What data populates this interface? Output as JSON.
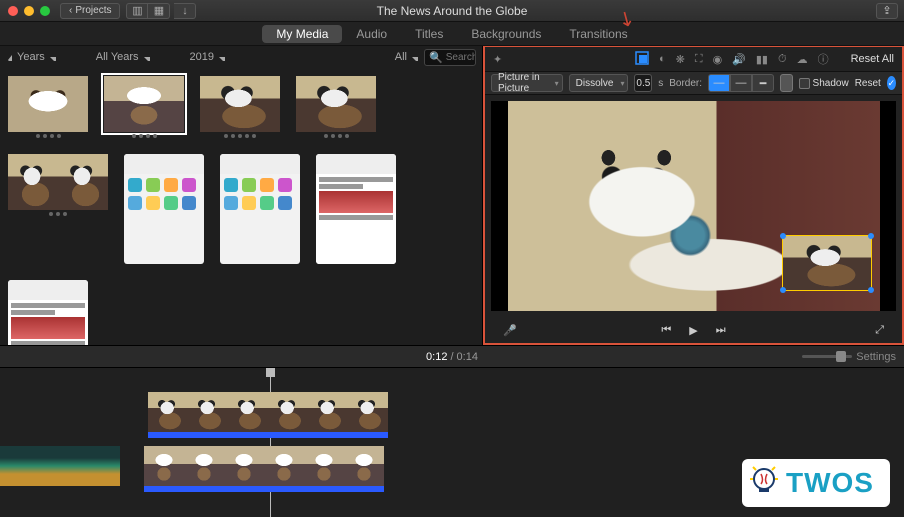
{
  "window": {
    "title": "The News Around the Globe",
    "back_label": "Projects"
  },
  "tabs": {
    "items": [
      "My Media",
      "Audio",
      "Titles",
      "Backgrounds",
      "Transitions"
    ],
    "active": "My Media"
  },
  "filters": {
    "years": "Years",
    "all_years": "All Years",
    "year": "2019",
    "all": "All",
    "search_placeholder": "Search"
  },
  "pip": {
    "mode": "Picture in Picture",
    "transition": "Dissolve",
    "duration": "0.5",
    "dur_unit": "s",
    "border_label": "Border:",
    "shadow_label": "Shadow",
    "reset": "Reset"
  },
  "viewer": {
    "reset_all": "Reset All"
  },
  "time": {
    "current": "0:12",
    "total": "0:14",
    "settings": "Settings"
  },
  "logo": {
    "text": "TWOS"
  }
}
